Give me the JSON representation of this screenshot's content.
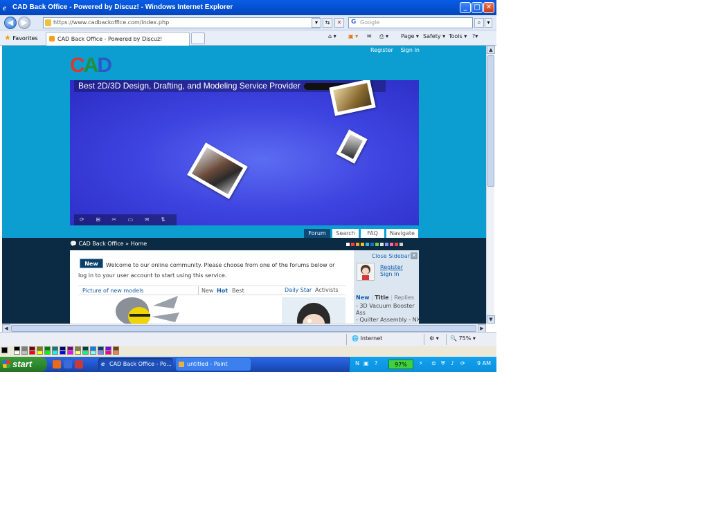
{
  "window": {
    "title": "CAD Back Office - Powered by Discuz! - Windows Internet Explorer",
    "controls": {
      "minimize": "_",
      "maximize": "□",
      "close": "✕"
    }
  },
  "navbar": {
    "url": "https://www.cadbackoffice.com/index.php",
    "search_placeholder": "Google",
    "search_engine_glyph": "G"
  },
  "favbar": {
    "favorites_label": "Favorites",
    "tab_title": "CAD Back Office - Powered by Discuz!",
    "commands": [
      "Page ▾",
      "Safety ▾",
      "Tools ▾",
      "?▾"
    ]
  },
  "page": {
    "top_links": {
      "register": "Register",
      "sign_in": "Sign In"
    },
    "logo": {
      "c": "C",
      "a": "A",
      "d": "D"
    },
    "banner_headline": "Best 2D/3D Design, Drafting, and Modeling Service Provider",
    "banner_headline_end": "!",
    "banner_controls": "⟳ ⊞ ✂ ▭ ✉ ⇅",
    "nav_tabs": [
      {
        "label": "Forum",
        "active": true
      },
      {
        "label": "Search",
        "active": false
      },
      {
        "label": "FAQ",
        "active": false
      },
      {
        "label": "Navigate",
        "active": false
      }
    ],
    "breadcrumb": "CAD Back Office » Home",
    "swatch_colors": [
      "#ffffff",
      "#ff3b3b",
      "#ffa030",
      "#f0c020",
      "#3ab8e0",
      "#1e6fb8",
      "#6fd04a",
      "#e0e0e0",
      "#9090ff",
      "#ff66aa",
      "#ff4040",
      "#d0d0d0"
    ],
    "welcome_badge": "New",
    "welcome_text": "Welcome to our online community. Please choose from one of the forums below or log in to your user account to start using this service.",
    "models_tab": "Picture of new models",
    "model_filters": [
      "New",
      "Hot",
      "Best"
    ],
    "daily_tabs": [
      "Daily Star",
      "Activists"
    ],
    "sidebar": {
      "close_label": "Close Sidebar",
      "register": "Register",
      "sign_in": "Sign In",
      "tabs": [
        "New",
        "Title",
        "Replies"
      ],
      "tab_separator": "|",
      "items": [
        "- 3D Vacuum Booster",
        "Ass",
        "- Quilter Assembly - NX"
      ]
    }
  },
  "statusbar": {
    "zone": "Internet",
    "zoom": "75%"
  },
  "palette_colors": [
    "#000000",
    "#808080",
    "#800000",
    "#808000",
    "#008000",
    "#008080",
    "#000080",
    "#800080",
    "#808040",
    "#004040",
    "#0080ff",
    "#004080",
    "#8000ff",
    "#804000",
    "#ffffff",
    "#c0c0c0",
    "#ff0000",
    "#ffff00",
    "#00ff00",
    "#00ffff",
    "#0000ff",
    "#ff00ff",
    "#ffff80",
    "#00ff80",
    "#80ffff",
    "#8080ff",
    "#ff0080",
    "#ff8040"
  ],
  "taskbar": {
    "start_label": "start",
    "items": [
      {
        "label": "CAD Back Office - Po...",
        "active": true
      },
      {
        "label": "untitled - Paint",
        "active": false
      }
    ],
    "battery": "97%",
    "clock": "9 AM"
  }
}
